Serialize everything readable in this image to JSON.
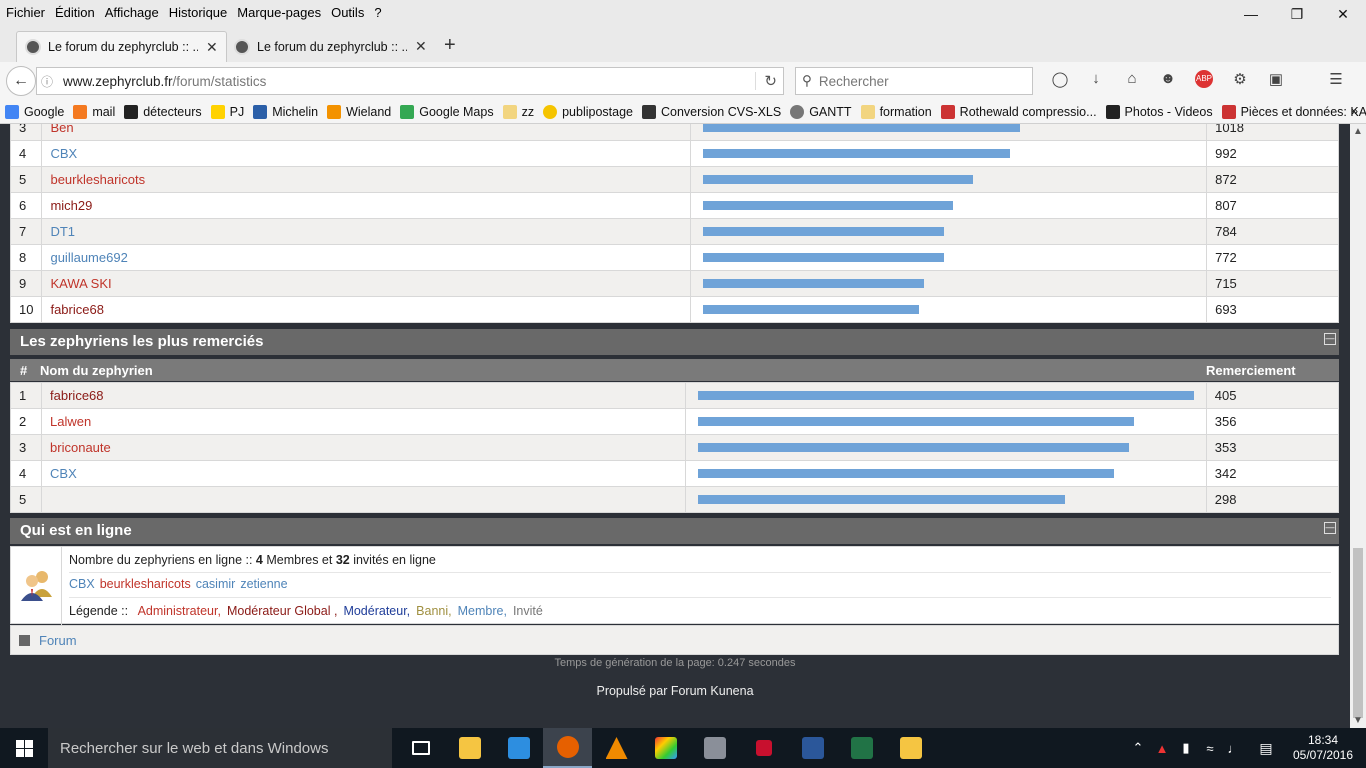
{
  "menu": [
    "Fichier",
    "Édition",
    "Affichage",
    "Historique",
    "Marque-pages",
    "Outils",
    "?"
  ],
  "tabs": [
    {
      "title": "Le forum du zephyrclub :: ..."
    },
    {
      "title": "Le forum du zephyrclub :: ..."
    }
  ],
  "url": {
    "host": "www.zephyrclub.fr",
    "path": "/forum/statistics"
  },
  "search": {
    "placeholder": "Rechercher"
  },
  "bookmarks": [
    "Google",
    "mail",
    "détecteurs",
    "PJ",
    "Michelin",
    "Wieland",
    "Google Maps",
    "zz",
    "publipostage",
    "Conversion CVS-XLS",
    "GANTT",
    "formation",
    "Rothewald compressio...",
    "Photos - Videos",
    "Pièces et données: KA..."
  ],
  "top_posters": {
    "rows": [
      {
        "rank": "3",
        "name": "Ben",
        "role": "admin",
        "pct": 0.645,
        "value": "1018"
      },
      {
        "rank": "4",
        "name": "CBX",
        "role": "member",
        "pct": 0.625,
        "value": "992"
      },
      {
        "rank": "5",
        "name": "beurklesharicots",
        "role": "admin",
        "pct": 0.55,
        "value": "872"
      },
      {
        "rank": "6",
        "name": "mich29",
        "role": "dark",
        "pct": 0.51,
        "value": "807"
      },
      {
        "rank": "7",
        "name": "DT1",
        "role": "member",
        "pct": 0.49,
        "value": "784"
      },
      {
        "rank": "8",
        "name": "guillaume692",
        "role": "member",
        "pct": 0.49,
        "value": "772"
      },
      {
        "rank": "9",
        "name": "KAWA SKI",
        "role": "admin",
        "pct": 0.45,
        "value": "715"
      },
      {
        "rank": "10",
        "name": "fabrice68",
        "role": "dark",
        "pct": 0.44,
        "value": "693"
      }
    ]
  },
  "thanked": {
    "title": "Les zephyriens les plus remerciés",
    "col_rank": "#",
    "col_name": "Nom du zephyrien",
    "col_value": "Remerciement",
    "rows": [
      {
        "rank": "1",
        "name": "fabrice68",
        "role": "dark",
        "pct": 1.0,
        "value": "405"
      },
      {
        "rank": "2",
        "name": "Lalwen",
        "role": "admin",
        "pct": 0.88,
        "value": "356"
      },
      {
        "rank": "3",
        "name": "briconaute",
        "role": "admin",
        "pct": 0.87,
        "value": "353"
      },
      {
        "rank": "4",
        "name": "CBX",
        "role": "member",
        "pct": 0.84,
        "value": "342"
      },
      {
        "rank": "5",
        "name": "",
        "role": "admin",
        "pct": 0.74,
        "value": "298"
      }
    ]
  },
  "online": {
    "title": "Qui est en ligne",
    "count_prefix": "Nombre du zephyriens en ligne :: ",
    "members": "4",
    "members_label": " Membres et ",
    "guests": "32",
    "guests_label": " invités en ligne",
    "users": [
      {
        "name": "CBX",
        "role": "member"
      },
      {
        "name": "beurklesharicots",
        "role": "admin"
      },
      {
        "name": "casimir",
        "role": "member"
      },
      {
        "name": "zetienne",
        "role": "member"
      }
    ],
    "legend_label": "Légende ::",
    "legend": [
      {
        "label": "Administrateur,",
        "color": "#c0342a"
      },
      {
        "label": "Modérateur Global ,",
        "color": "#8b1a16"
      },
      {
        "label": "Modérateur,",
        "color": "#1f3d99"
      },
      {
        "label": "Banni,",
        "color": "#a09040"
      },
      {
        "label": "Membre,",
        "color": "#4f84b8"
      },
      {
        "label": "Invité",
        "color": "#777777"
      }
    ]
  },
  "forum_link": "Forum",
  "gen_time": "Temps de génération de la page: 0.247 secondes",
  "powered_by": "Propulsé par Forum Kunena",
  "taskbar": {
    "search_placeholder": "Rechercher sur le web et dans Windows",
    "time": "18:34",
    "date": "05/07/2016"
  },
  "colors": {
    "bar": "#6fa3d8",
    "admin": "#c0342a",
    "member": "#4f84b8",
    "header": "#696969"
  }
}
